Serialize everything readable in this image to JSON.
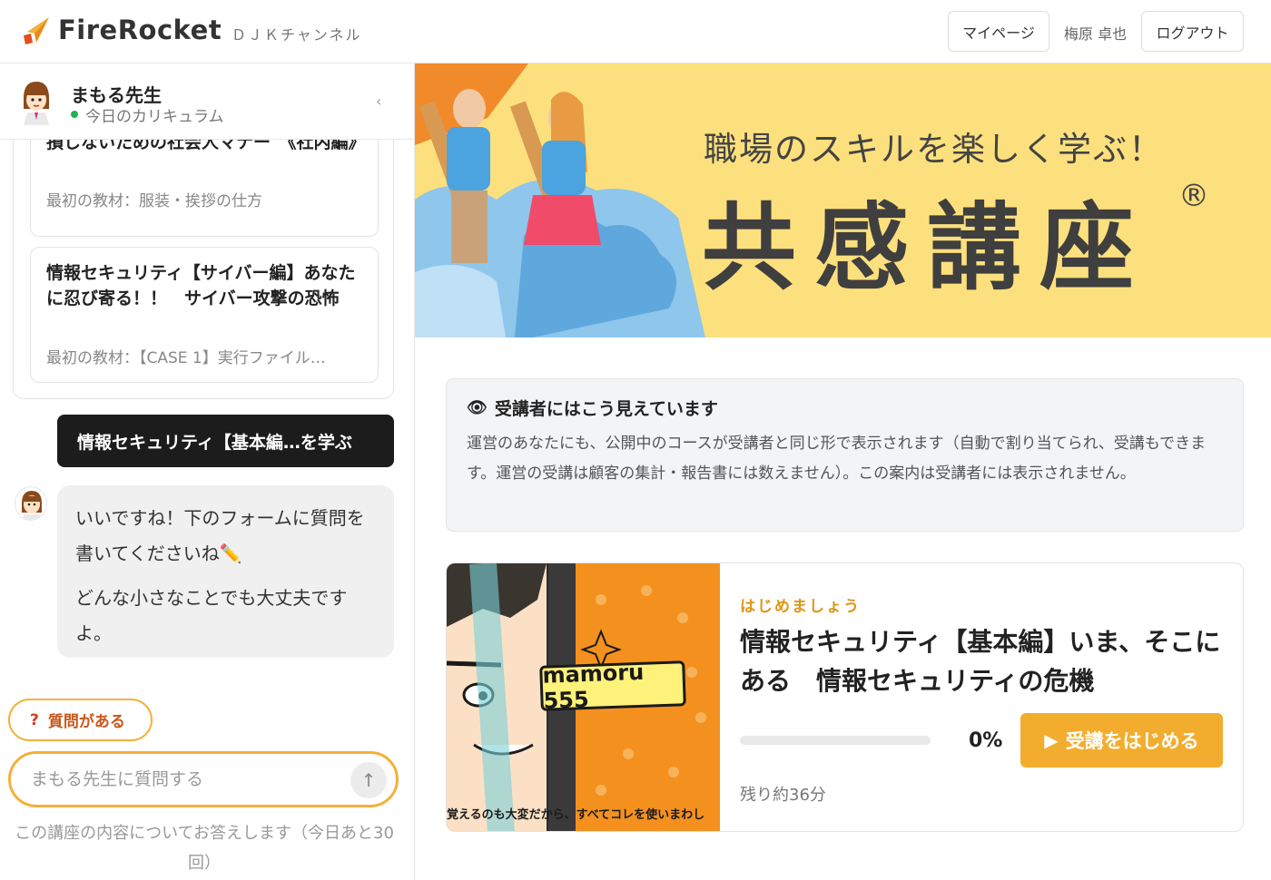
{
  "header": {
    "brand": "FireRocket",
    "channel": "ＤＪＫチャンネル",
    "mypage_label": "マイページ",
    "user_name": "梅原 卓也",
    "logout_label": "ログアウト"
  },
  "sidebar": {
    "teacher_name": "まもる先生",
    "teacher_status": "今日のカリキュラム",
    "collapse_icon": "‹",
    "courses": [
      {
        "title": "損しないための社会人マナー　《社内編》",
        "first_material": "最初の教材：服装・挨拶の仕方"
      },
      {
        "title": "情報セキュリティ【サイバー編】あなたに忍び寄る！！　サイバー攻撃の恐怖",
        "first_material": "最初の教材：【CASE 1】実行ファイル…"
      }
    ],
    "user_message": "情報セキュリティ【基本編…を学ぶ",
    "bot_message_1": "いいですね！下のフォームに質問を書いてくださいね✏️",
    "bot_message_2": "どんな小さなことでも大丈夫ですよ。",
    "question_chip": "質問がある",
    "question_mark": "?",
    "ask_placeholder": "まもる先生に質問する",
    "send_icon": "↑",
    "remain_note": "この講座の内容についてお答えします（今日あと30回）"
  },
  "banner": {
    "subtitle": "職場のスキルを楽しく学ぶ！",
    "title": "共感講座",
    "registered_mark": "®"
  },
  "notice": {
    "icon": "eye-icon",
    "title": "受講者にはこう見えています",
    "body": "運営のあなたにも、公開中のコースが受講者と同じ形で表示されます（自動で割り当てられ、受講もできます。運営の受講は顧客の集計・報告書には数えません）。この案内は受講者には表示されません。"
  },
  "course": {
    "thumb_title": "mamoru 555",
    "thumb_caption": "覚えるのも大変だから、すべてコレを使いまわし",
    "kicker": "はじめましょう",
    "title": "情報セキュリティ【基本編】いま、そこにある　情報セキュリティの危機",
    "progress_pct": 0,
    "progress_label": "0%",
    "start_label": "受講をはじめる",
    "remaining": "残り約36分"
  },
  "colors": {
    "accent": "#f3b13a",
    "banner_bg": "#fde07e",
    "online": "#22b14c"
  }
}
